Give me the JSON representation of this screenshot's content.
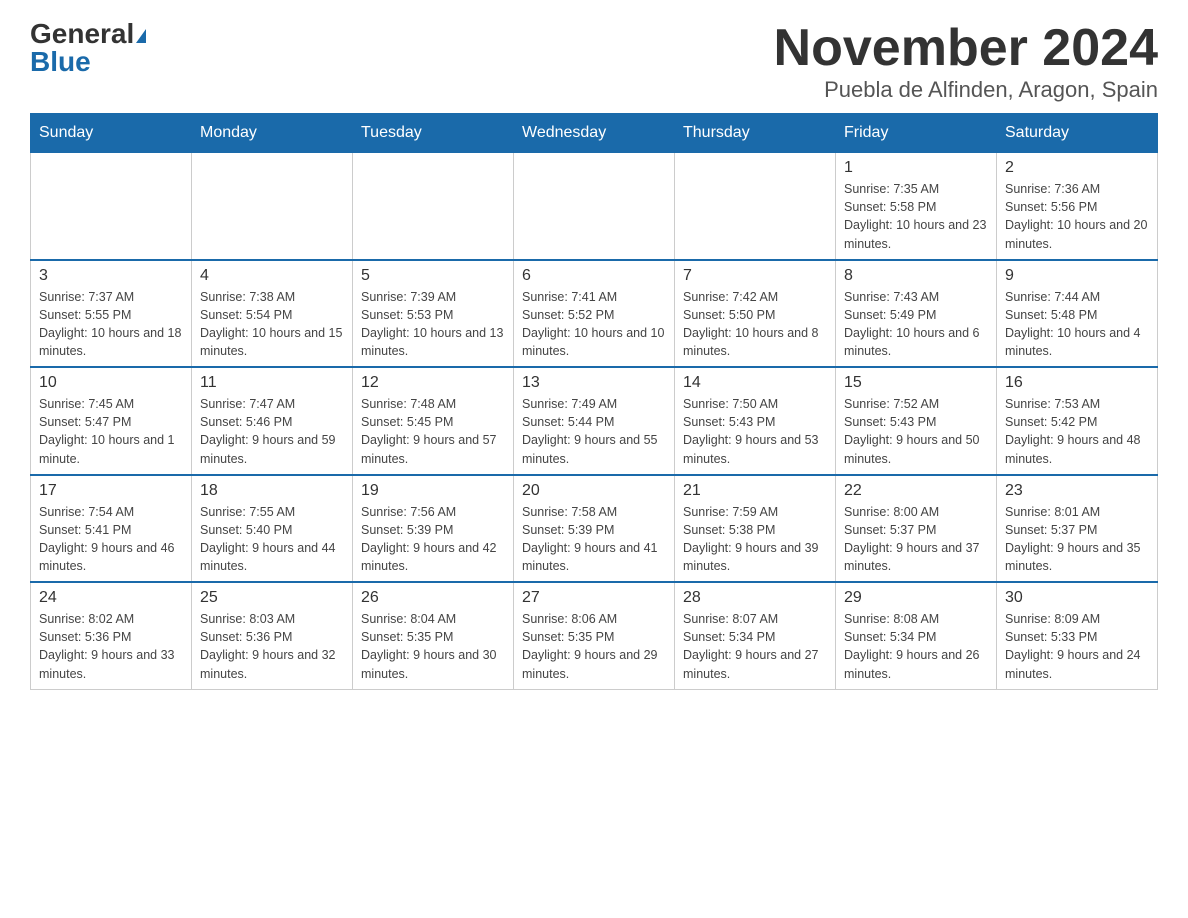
{
  "header": {
    "logo_general": "General",
    "logo_blue": "Blue",
    "month_title": "November 2024",
    "location": "Puebla de Alfinden, Aragon, Spain"
  },
  "days_of_week": [
    "Sunday",
    "Monday",
    "Tuesday",
    "Wednesday",
    "Thursday",
    "Friday",
    "Saturday"
  ],
  "weeks": [
    [
      {
        "day": "",
        "sunrise": "",
        "sunset": "",
        "daylight": ""
      },
      {
        "day": "",
        "sunrise": "",
        "sunset": "",
        "daylight": ""
      },
      {
        "day": "",
        "sunrise": "",
        "sunset": "",
        "daylight": ""
      },
      {
        "day": "",
        "sunrise": "",
        "sunset": "",
        "daylight": ""
      },
      {
        "day": "",
        "sunrise": "",
        "sunset": "",
        "daylight": ""
      },
      {
        "day": "1",
        "sunrise": "Sunrise: 7:35 AM",
        "sunset": "Sunset: 5:58 PM",
        "daylight": "Daylight: 10 hours and 23 minutes."
      },
      {
        "day": "2",
        "sunrise": "Sunrise: 7:36 AM",
        "sunset": "Sunset: 5:56 PM",
        "daylight": "Daylight: 10 hours and 20 minutes."
      }
    ],
    [
      {
        "day": "3",
        "sunrise": "Sunrise: 7:37 AM",
        "sunset": "Sunset: 5:55 PM",
        "daylight": "Daylight: 10 hours and 18 minutes."
      },
      {
        "day": "4",
        "sunrise": "Sunrise: 7:38 AM",
        "sunset": "Sunset: 5:54 PM",
        "daylight": "Daylight: 10 hours and 15 minutes."
      },
      {
        "day": "5",
        "sunrise": "Sunrise: 7:39 AM",
        "sunset": "Sunset: 5:53 PM",
        "daylight": "Daylight: 10 hours and 13 minutes."
      },
      {
        "day": "6",
        "sunrise": "Sunrise: 7:41 AM",
        "sunset": "Sunset: 5:52 PM",
        "daylight": "Daylight: 10 hours and 10 minutes."
      },
      {
        "day": "7",
        "sunrise": "Sunrise: 7:42 AM",
        "sunset": "Sunset: 5:50 PM",
        "daylight": "Daylight: 10 hours and 8 minutes."
      },
      {
        "day": "8",
        "sunrise": "Sunrise: 7:43 AM",
        "sunset": "Sunset: 5:49 PM",
        "daylight": "Daylight: 10 hours and 6 minutes."
      },
      {
        "day": "9",
        "sunrise": "Sunrise: 7:44 AM",
        "sunset": "Sunset: 5:48 PM",
        "daylight": "Daylight: 10 hours and 4 minutes."
      }
    ],
    [
      {
        "day": "10",
        "sunrise": "Sunrise: 7:45 AM",
        "sunset": "Sunset: 5:47 PM",
        "daylight": "Daylight: 10 hours and 1 minute."
      },
      {
        "day": "11",
        "sunrise": "Sunrise: 7:47 AM",
        "sunset": "Sunset: 5:46 PM",
        "daylight": "Daylight: 9 hours and 59 minutes."
      },
      {
        "day": "12",
        "sunrise": "Sunrise: 7:48 AM",
        "sunset": "Sunset: 5:45 PM",
        "daylight": "Daylight: 9 hours and 57 minutes."
      },
      {
        "day": "13",
        "sunrise": "Sunrise: 7:49 AM",
        "sunset": "Sunset: 5:44 PM",
        "daylight": "Daylight: 9 hours and 55 minutes."
      },
      {
        "day": "14",
        "sunrise": "Sunrise: 7:50 AM",
        "sunset": "Sunset: 5:43 PM",
        "daylight": "Daylight: 9 hours and 53 minutes."
      },
      {
        "day": "15",
        "sunrise": "Sunrise: 7:52 AM",
        "sunset": "Sunset: 5:43 PM",
        "daylight": "Daylight: 9 hours and 50 minutes."
      },
      {
        "day": "16",
        "sunrise": "Sunrise: 7:53 AM",
        "sunset": "Sunset: 5:42 PM",
        "daylight": "Daylight: 9 hours and 48 minutes."
      }
    ],
    [
      {
        "day": "17",
        "sunrise": "Sunrise: 7:54 AM",
        "sunset": "Sunset: 5:41 PM",
        "daylight": "Daylight: 9 hours and 46 minutes."
      },
      {
        "day": "18",
        "sunrise": "Sunrise: 7:55 AM",
        "sunset": "Sunset: 5:40 PM",
        "daylight": "Daylight: 9 hours and 44 minutes."
      },
      {
        "day": "19",
        "sunrise": "Sunrise: 7:56 AM",
        "sunset": "Sunset: 5:39 PM",
        "daylight": "Daylight: 9 hours and 42 minutes."
      },
      {
        "day": "20",
        "sunrise": "Sunrise: 7:58 AM",
        "sunset": "Sunset: 5:39 PM",
        "daylight": "Daylight: 9 hours and 41 minutes."
      },
      {
        "day": "21",
        "sunrise": "Sunrise: 7:59 AM",
        "sunset": "Sunset: 5:38 PM",
        "daylight": "Daylight: 9 hours and 39 minutes."
      },
      {
        "day": "22",
        "sunrise": "Sunrise: 8:00 AM",
        "sunset": "Sunset: 5:37 PM",
        "daylight": "Daylight: 9 hours and 37 minutes."
      },
      {
        "day": "23",
        "sunrise": "Sunrise: 8:01 AM",
        "sunset": "Sunset: 5:37 PM",
        "daylight": "Daylight: 9 hours and 35 minutes."
      }
    ],
    [
      {
        "day": "24",
        "sunrise": "Sunrise: 8:02 AM",
        "sunset": "Sunset: 5:36 PM",
        "daylight": "Daylight: 9 hours and 33 minutes."
      },
      {
        "day": "25",
        "sunrise": "Sunrise: 8:03 AM",
        "sunset": "Sunset: 5:36 PM",
        "daylight": "Daylight: 9 hours and 32 minutes."
      },
      {
        "day": "26",
        "sunrise": "Sunrise: 8:04 AM",
        "sunset": "Sunset: 5:35 PM",
        "daylight": "Daylight: 9 hours and 30 minutes."
      },
      {
        "day": "27",
        "sunrise": "Sunrise: 8:06 AM",
        "sunset": "Sunset: 5:35 PM",
        "daylight": "Daylight: 9 hours and 29 minutes."
      },
      {
        "day": "28",
        "sunrise": "Sunrise: 8:07 AM",
        "sunset": "Sunset: 5:34 PM",
        "daylight": "Daylight: 9 hours and 27 minutes."
      },
      {
        "day": "29",
        "sunrise": "Sunrise: 8:08 AM",
        "sunset": "Sunset: 5:34 PM",
        "daylight": "Daylight: 9 hours and 26 minutes."
      },
      {
        "day": "30",
        "sunrise": "Sunrise: 8:09 AM",
        "sunset": "Sunset: 5:33 PM",
        "daylight": "Daylight: 9 hours and 24 minutes."
      }
    ]
  ]
}
